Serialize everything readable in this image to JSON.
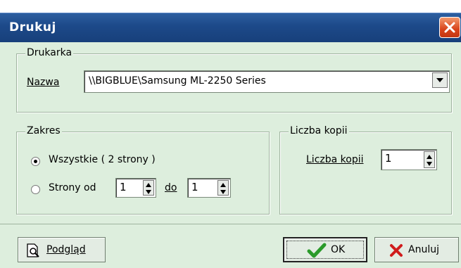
{
  "window": {
    "title": "Drukuj"
  },
  "printer_group": {
    "legend": "Drukarka",
    "name_label": "Nazwa",
    "printer_value": "\\\\BIGBLUE\\Samsung ML-2250 Series"
  },
  "range_group": {
    "legend": "Zakres",
    "all_option": "Wszystkie ( 2 strony )",
    "pages_option": "Strony od",
    "from_value": "1",
    "to_label": "do",
    "to_value": "1",
    "selected": "all"
  },
  "copies_group": {
    "legend": "Liczba kopii",
    "copies_label": "Liczba kopii",
    "copies_value": "1"
  },
  "buttons": {
    "preview": "Podgląd",
    "ok": "OK",
    "cancel": "Anuluj"
  }
}
